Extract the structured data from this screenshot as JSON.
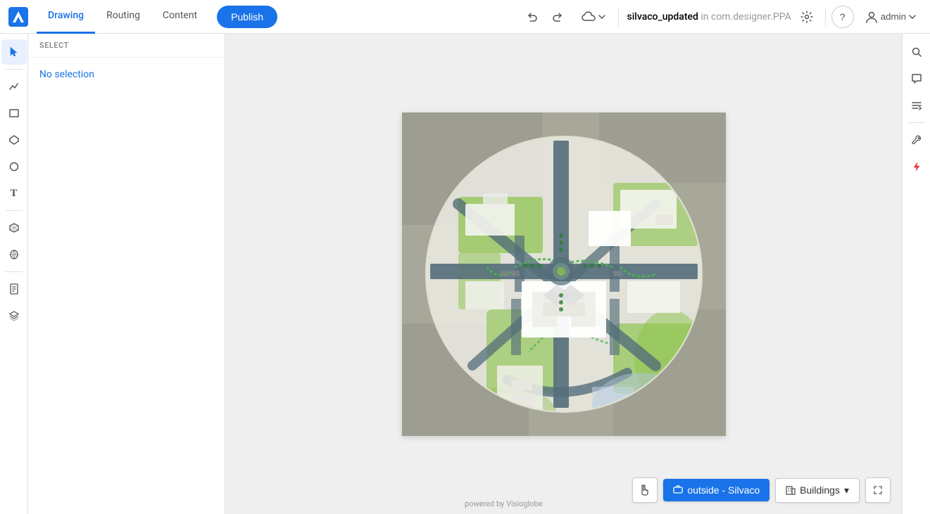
{
  "header": {
    "logo_text": "V",
    "tabs": [
      {
        "id": "drawing",
        "label": "Drawing",
        "active": true
      },
      {
        "id": "routing",
        "label": "Routing",
        "active": false
      },
      {
        "id": "content",
        "label": "Content",
        "active": false
      }
    ],
    "publish_label": "Publish",
    "project_name": "silvaco_updated",
    "project_suffix": " in com.designer.PPA",
    "user_label": "admin"
  },
  "left_toolbar": {
    "tools": [
      {
        "id": "select",
        "icon": "✦",
        "label": "select-tool"
      },
      {
        "id": "analytics",
        "icon": "📈",
        "label": "analytics-tool"
      },
      {
        "id": "rectangle",
        "icon": "□",
        "label": "rectangle-tool"
      },
      {
        "id": "polygon",
        "icon": "⬠",
        "label": "polygon-tool"
      },
      {
        "id": "circle",
        "icon": "○",
        "label": "circle-tool"
      },
      {
        "id": "text",
        "icon": "T",
        "label": "text-tool"
      },
      {
        "id": "3d",
        "icon": "⬡",
        "label": "3d-tool"
      },
      {
        "id": "image",
        "icon": "🏔",
        "label": "image-tool"
      },
      {
        "id": "doc",
        "icon": "📄",
        "label": "document-tool"
      },
      {
        "id": "layers",
        "icon": "⊞",
        "label": "layers-tool"
      }
    ]
  },
  "left_panel": {
    "section_title": "SELECT",
    "no_selection_text": "No selection"
  },
  "canvas": {
    "powered_by": "powered by Visioglobe"
  },
  "bottom_bar": {
    "location_label": "outside - Silvaco",
    "buildings_label": "Buildings",
    "buildings_arrow": "▾"
  },
  "right_sidebar": {
    "icons": [
      {
        "id": "search",
        "icon": "🔍",
        "label": "search-icon"
      },
      {
        "id": "comments",
        "icon": "💬",
        "label": "comments-icon"
      },
      {
        "id": "list",
        "icon": "≡",
        "label": "list-icon"
      },
      {
        "id": "wrench",
        "icon": "🔧",
        "label": "wrench-icon"
      },
      {
        "id": "flash",
        "icon": "⚡",
        "label": "flash-icon"
      }
    ]
  }
}
